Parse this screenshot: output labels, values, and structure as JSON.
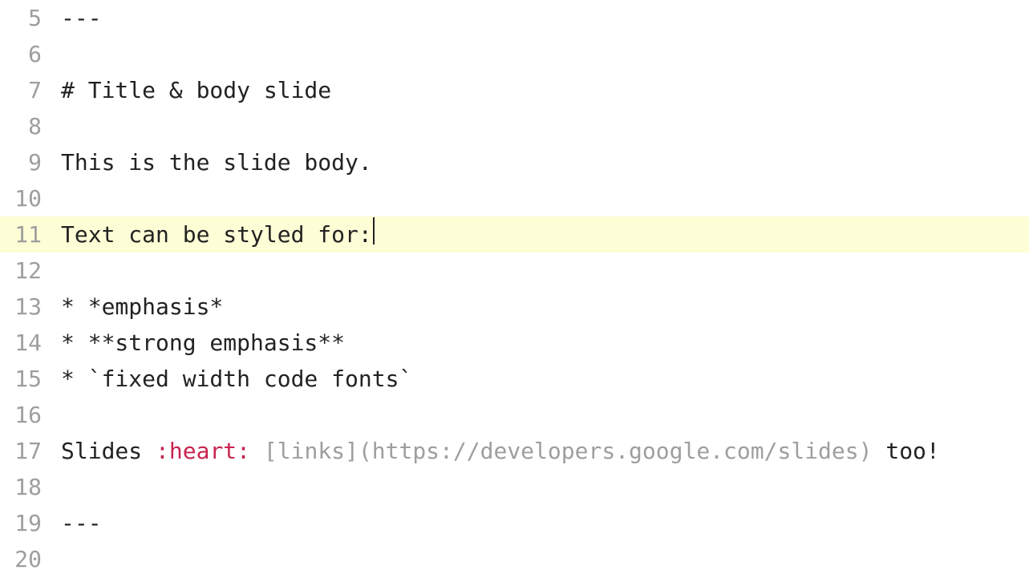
{
  "editor": {
    "active_line": 11,
    "lines": [
      {
        "num": 5,
        "segments": [
          {
            "cls": "tok-plain",
            "text": "---"
          }
        ]
      },
      {
        "num": 6,
        "segments": []
      },
      {
        "num": 7,
        "segments": [
          {
            "cls": "tok-heading",
            "text": "# Title & body slide"
          }
        ]
      },
      {
        "num": 8,
        "segments": []
      },
      {
        "num": 9,
        "segments": [
          {
            "cls": "tok-plain",
            "text": "This is the slide body."
          }
        ]
      },
      {
        "num": 10,
        "segments": []
      },
      {
        "num": 11,
        "segments": [
          {
            "cls": "tok-plain",
            "text": "Text can be styled for:"
          }
        ],
        "cursor": true
      },
      {
        "num": 12,
        "segments": []
      },
      {
        "num": 13,
        "segments": [
          {
            "cls": "tok-plain",
            "text": "* *emphasis*"
          }
        ]
      },
      {
        "num": 14,
        "segments": [
          {
            "cls": "tok-plain",
            "text": "* **strong emphasis**"
          }
        ]
      },
      {
        "num": 15,
        "segments": [
          {
            "cls": "tok-plain",
            "text": "* `fixed width code fonts`"
          }
        ]
      },
      {
        "num": 16,
        "segments": []
      },
      {
        "num": 17,
        "segments": [
          {
            "cls": "tok-plain",
            "text": "Slides "
          },
          {
            "cls": "tok-emoji",
            "text": ":heart:"
          },
          {
            "cls": "tok-plain",
            "text": " "
          },
          {
            "cls": "tok-link",
            "text": "[links](https://developers.google.com/slides)"
          },
          {
            "cls": "tok-plain",
            "text": " too!"
          }
        ]
      },
      {
        "num": 18,
        "segments": []
      },
      {
        "num": 19,
        "segments": [
          {
            "cls": "tok-plain",
            "text": "---"
          }
        ]
      },
      {
        "num": 20,
        "segments": []
      }
    ]
  }
}
